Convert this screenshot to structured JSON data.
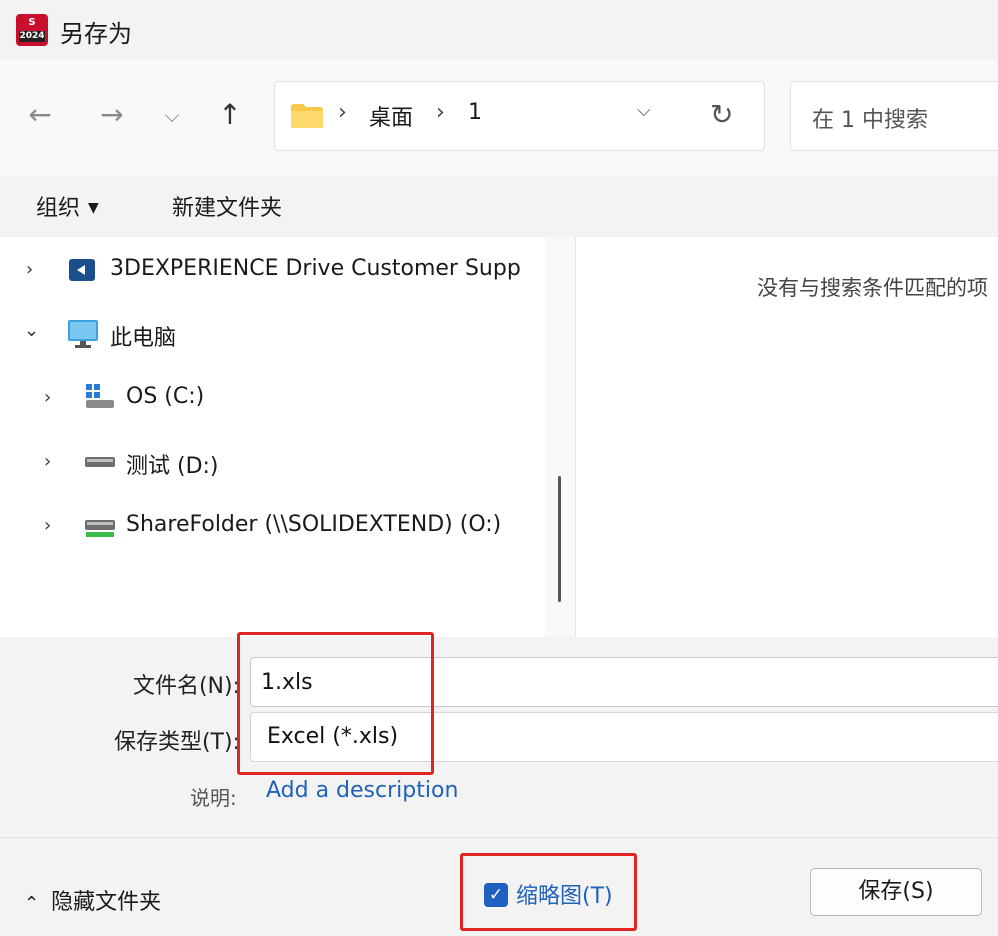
{
  "window": {
    "title": "另存为",
    "app_icon_text": "2024"
  },
  "nav": {
    "back_icon": "←",
    "forward_icon": "→",
    "recent_icon": "⌵",
    "up_icon": "↑",
    "breadcrumbs": [
      "桌面",
      "1"
    ],
    "separator": "›",
    "dropdown_icon": "⌵",
    "refresh_icon": "↻",
    "search_placeholder": "在 1 中搜索"
  },
  "commands": {
    "organize": "组织",
    "organize_caret": "▼",
    "new_folder": "新建文件夹"
  },
  "tree": [
    {
      "label": "3DEXPERIENCE Drive Customer Supp",
      "chevron": "›",
      "icon": "cloud-drive-icon"
    },
    {
      "label": "此电脑",
      "chevron": "⌄",
      "icon": "computer-icon"
    },
    {
      "label": "OS (C:)",
      "chevron": "›",
      "icon": "system-drive-icon"
    },
    {
      "label": "测试 (D:)",
      "chevron": "›",
      "icon": "drive-icon"
    },
    {
      "label": "ShareFolder (\\\\SOLIDEXTEND) (O:)",
      "chevron": "›",
      "icon": "network-drive-icon"
    }
  ],
  "content": {
    "empty_message": "没有与搜索条件匹配的项"
  },
  "form": {
    "filename_label": "文件名(N):",
    "filename_value": "1.xls",
    "filetype_label": "保存类型(T):",
    "filetype_value": "Excel (*.xls)",
    "description_label": "说明:",
    "description_link": "Add a description"
  },
  "footer": {
    "hide_folders": "隐藏文件夹",
    "hide_caret": "⌃",
    "thumbnail_label": "缩略图(T)",
    "thumbnail_checked": true,
    "checkmark": "✓",
    "save_button": "保存(S)"
  },
  "colors": {
    "accent": "#1e5fbf",
    "highlight": "#e02424",
    "link": "#1f62b8"
  }
}
